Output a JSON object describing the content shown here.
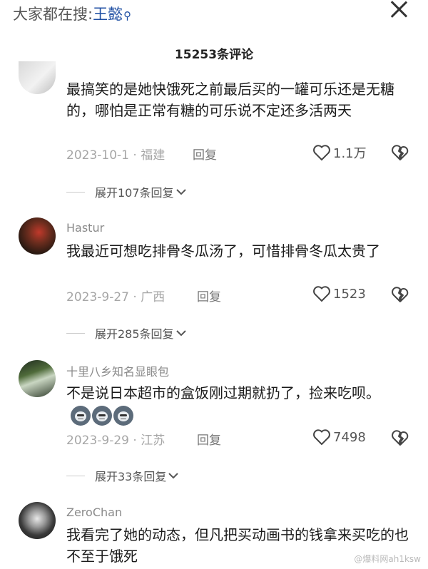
{
  "search": {
    "prefix": "大家都在搜:",
    "keyword": "王懿"
  },
  "comment_count": "15253条评论",
  "comments": [
    {
      "username": "",
      "text": "最搞笑的是她快饿死之前最后买的一罐可乐还是无糖的，哪怕是正常有糖的可乐说不定还多活两天",
      "date_location": "2023-10-1 · 福建",
      "reply_label": "回复",
      "likes": "1.1万",
      "expand_label": "展开107条回复"
    },
    {
      "username": "Hastur",
      "text": "我最近可想吃排骨冬瓜汤了，可惜排骨冬瓜太贵了",
      "date_location": "2023-9-27 · 广西",
      "reply_label": "回复",
      "likes": "1523",
      "expand_label": "展开285条回复"
    },
    {
      "username": "十里八乡知名显眼包",
      "text": "不是说日本超市的盒饭刚过期就扔了，捡来吃呗。",
      "date_location": "2023-9-29 · 江苏",
      "reply_label": "回复",
      "likes": "7498",
      "expand_label": "展开33条回复"
    },
    {
      "username": "ZeroChan",
      "text": "我看完了她的动态，但凡把买动画书的钱拿来买吃的也不至于饿死"
    }
  ],
  "watermark": "@爆料网ah1ksw",
  "icons": {
    "search": "search-icon",
    "close": "close-icon",
    "like": "heart-outline-icon",
    "dislike": "broken-heart-icon",
    "expand": "chevron-down-icon"
  }
}
